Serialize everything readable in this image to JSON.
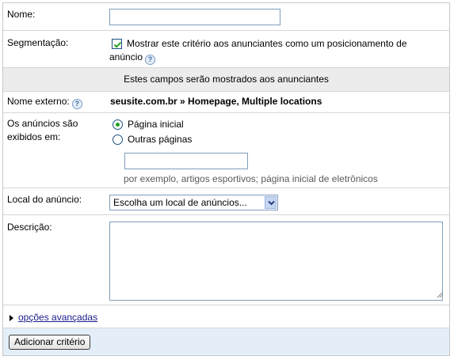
{
  "name_row": {
    "label": "Nome:",
    "value": ""
  },
  "segmentation_row": {
    "label": "Segmentação:",
    "checkbox_checked": true,
    "checkbox_text_line1": "Mostrar este critério aos anunciantes como um posicionamento de",
    "checkbox_text_line2": "anúncio",
    "help_icon": "help-icon"
  },
  "advertiser_band": {
    "text": "Estes campos serão mostrados aos anunciantes"
  },
  "external_name_row": {
    "label": "Nome externo:",
    "value": "seusite.com.br » Homepage, Multiple locations",
    "help_icon": "help-icon"
  },
  "display_row": {
    "label_line1": "Os anúncios são",
    "label_line2": "exibidos em:",
    "options": [
      {
        "label": "Página inicial",
        "selected": true
      },
      {
        "label": "Outras páginas",
        "selected": false
      }
    ],
    "other_pages_value": "",
    "hint": "por exemplo, artigos esportivos; página inicial de eletrônicos"
  },
  "location_row": {
    "label": "Local do anúncio:",
    "selected": "Escolha um local de anúncios..."
  },
  "description_row": {
    "label": "Descrição:",
    "value": ""
  },
  "advanced": {
    "label": "opções avançadas",
    "icon": "triangle-right-icon"
  },
  "footer": {
    "submit_label": "Adicionar critério"
  },
  "colors": {
    "band_bg": "#ececec",
    "footer_bg": "#e3eef8",
    "link": "#1a1a8c",
    "radio_dot": "#21a121"
  }
}
